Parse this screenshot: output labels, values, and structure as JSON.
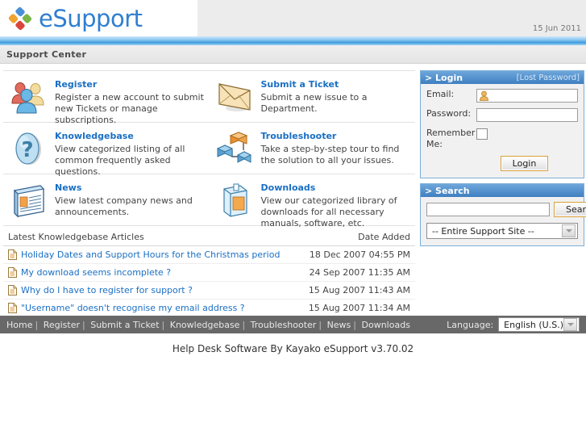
{
  "header": {
    "logo_text": "eSupport",
    "logo_icon": "kayako-diamond-logo",
    "date": "15 Jun 2011",
    "subtitle": "Support Center"
  },
  "features": [
    {
      "title": "Register",
      "desc": "Register a new account to submit new Tickets or manage subscriptions.",
      "icon": "users-group-icon"
    },
    {
      "title": "Submit a Ticket",
      "desc": "Submit a new issue to a Department.",
      "icon": "envelope-icon"
    },
    {
      "title": "Knowledgebase",
      "desc": "View categorized listing of all common frequently asked questions.",
      "icon": "question-mark-icon"
    },
    {
      "title": "Troubleshooter",
      "desc": "Take a step-by-step tour to find the solution to all your issues.",
      "icon": "network-nodes-icon"
    },
    {
      "title": "News",
      "desc": "View latest company news and announcements.",
      "icon": "newspaper-icon"
    },
    {
      "title": "Downloads",
      "desc": "View our categorized library of downloads for all necessary manuals, software, etc.",
      "icon": "software-box-icon"
    }
  ],
  "articles": {
    "heading": "Latest Knowledgebase Articles",
    "date_heading": "Date Added",
    "rows": [
      {
        "title": "Holiday Dates and Support Hours for the Christmas period",
        "date": "18 Dec 2007 04:55 PM"
      },
      {
        "title": "My download seems incomplete ?",
        "date": "24 Sep 2007 11:35 AM"
      },
      {
        "title": "Why do I have to register for support ?",
        "date": "15 Aug 2007 11:43 AM"
      },
      {
        "title": "\"Username\" doesn't recognise my email address ?",
        "date": "15 Aug 2007 11:34 AM"
      }
    ]
  },
  "login": {
    "title": "> Login",
    "lost_password": "[Lost Password]",
    "email_label": "Email:",
    "email_value": "",
    "password_label": "Password:",
    "password_value": "",
    "remember_label": "Remember Me:",
    "remember_checked": false,
    "submit_label": "Login"
  },
  "search": {
    "title": "> Search",
    "query_value": "",
    "button_label": "Search",
    "scope_selected": "-- Entire Support Site --"
  },
  "footer": {
    "nav": [
      "Home",
      "Register",
      "Submit a Ticket",
      "Knowledgebase",
      "Troubleshooter",
      "News",
      "Downloads"
    ],
    "language_label": "Language:",
    "language_selected": "English (U.S.)"
  },
  "copyright": "Help Desk Software By Kayako eSupport v3.70.02",
  "colors": {
    "brand_blue": "#2f7fd0",
    "link_blue": "#1a6fc4",
    "panel_header": "#3f7fc1",
    "footer_bg": "#686868",
    "accent_bar": "#3f9bdf"
  }
}
